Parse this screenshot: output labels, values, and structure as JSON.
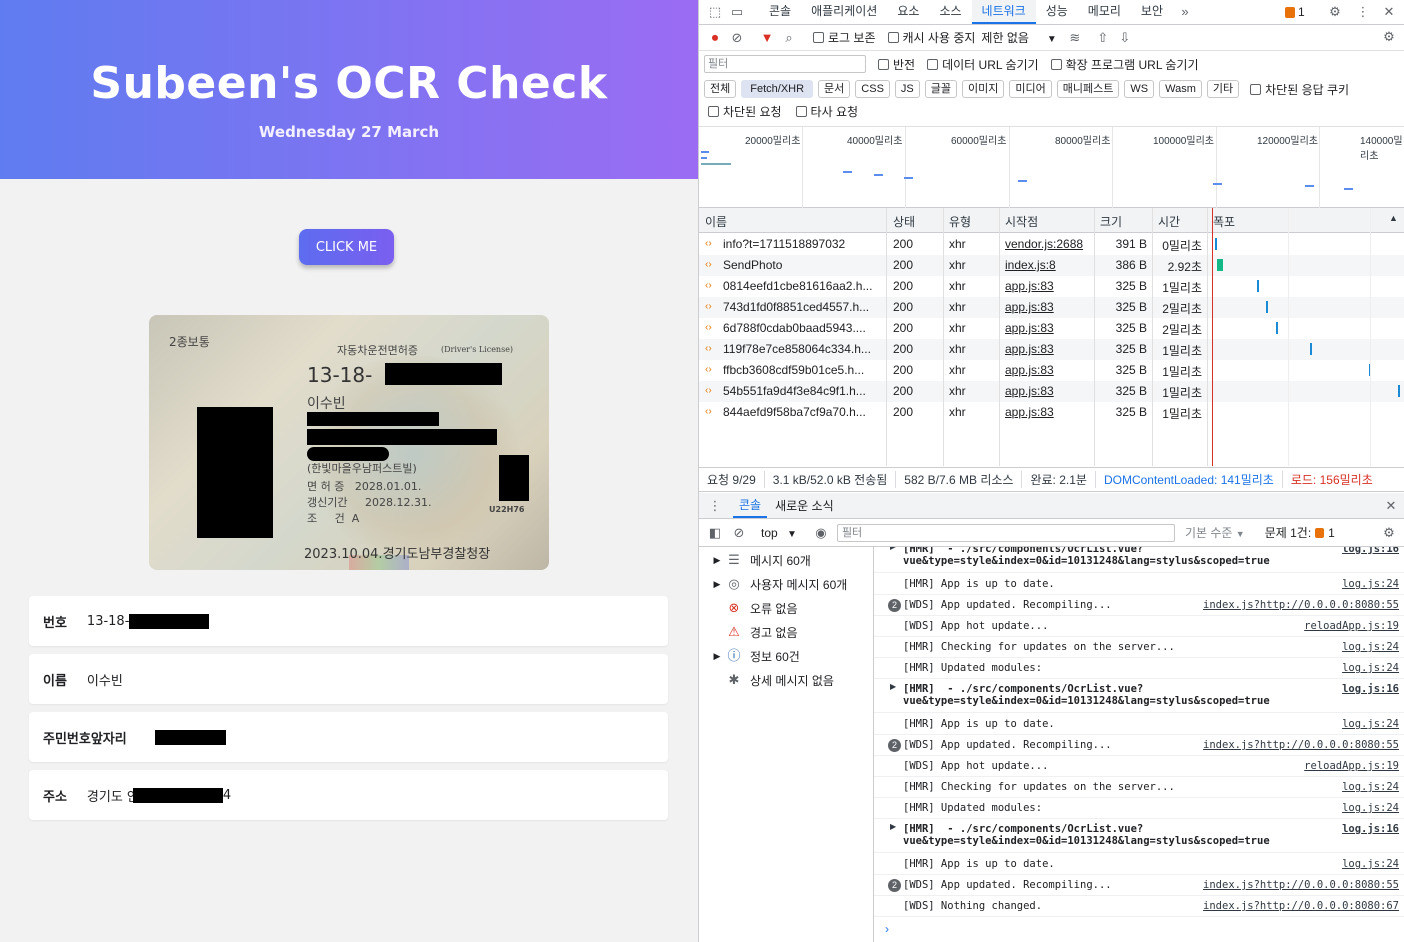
{
  "app": {
    "title": "Subeen's OCR Check",
    "date": "Wednesday 27 March",
    "button_label": "CLICK ME",
    "license": {
      "type": "2종보통",
      "header": "자동차운전면허증",
      "header_en": "(Driver's License)",
      "number_prefix": "13-18-",
      "name": "이수빈",
      "address_suffix": "(한빛마을우남퍼스트빌)",
      "renew": "면 허 증   2028.01.01.",
      "expiry": "갱신기간     2028.12.31.",
      "conditions": "조     건  A",
      "issue": "2023.10.04.경기도남부경찰청장",
      "code": "U22H76"
    },
    "fields": [
      {
        "label": "번호",
        "value": "13-18-"
      },
      {
        "label": "이름",
        "value": "이수빈"
      },
      {
        "label": "주민번호앞자리",
        "value": ""
      },
      {
        "label": "주소",
        "value": "경기도 안",
        "value_suffix": "4"
      }
    ]
  },
  "devtools": {
    "tabs": [
      "콘솔",
      "애플리케이션",
      "요소",
      "소스",
      "네트워크",
      "성능",
      "메모리",
      "보안"
    ],
    "active_tab": "네트워크",
    "issues_count": "1",
    "toolbar": {
      "preserve_log": "로그 보존",
      "disable_cache": "캐시 사용 중지",
      "throttle": "제한 없음"
    },
    "filter": {
      "placeholder": "필터",
      "invert": "반전",
      "hide_data_urls": "데이터 URL 숨기기",
      "hide_ext_urls": "확장 프로그램 URL 숨기기"
    },
    "types": [
      "전체",
      "Fetch/XHR",
      "문서",
      "CSS",
      "JS",
      "글꼴",
      "이미지",
      "미디어",
      "매니페스트",
      "WS",
      "Wasm",
      "기타"
    ],
    "active_type": "Fetch/XHR",
    "blocked_cookies": "차단된 응답 쿠키",
    "blocked_requests": "차단된 요청",
    "third_party": "타사 요청",
    "timeline_ticks": [
      "20000밀리초",
      "40000밀리초",
      "60000밀리초",
      "80000밀리초",
      "100000밀리초",
      "120000밀리초",
      "140000밀리초"
    ],
    "columns": [
      "이름",
      "상태",
      "유형",
      "시작점",
      "크기",
      "시간",
      "폭포"
    ],
    "requests": [
      {
        "name": "info?t=1711518897032",
        "status": "200",
        "type": "xhr",
        "initiator": "vendor.js:2688",
        "size": "391 B",
        "time": "0밀리초"
      },
      {
        "name": "SendPhoto",
        "status": "200",
        "type": "xhr",
        "initiator": "index.js:8",
        "size": "386 B",
        "time": "2.92초"
      },
      {
        "name": "0814eefd1cbe81616aa2.h...",
        "status": "200",
        "type": "xhr",
        "initiator": "app.js:83",
        "size": "325 B",
        "time": "1밀리초"
      },
      {
        "name": "743d1fd0f8851ced4557.h...",
        "status": "200",
        "type": "xhr",
        "initiator": "app.js:83",
        "size": "325 B",
        "time": "2밀리초"
      },
      {
        "name": "6d788f0cdab0baad5943....",
        "status": "200",
        "type": "xhr",
        "initiator": "app.js:83",
        "size": "325 B",
        "time": "2밀리초"
      },
      {
        "name": "119f78e7ce858064c334.h...",
        "status": "200",
        "type": "xhr",
        "initiator": "app.js:83",
        "size": "325 B",
        "time": "1밀리초"
      },
      {
        "name": "ffbcb3608cdf59b01ce5.h...",
        "status": "200",
        "type": "xhr",
        "initiator": "app.js:83",
        "size": "325 B",
        "time": "1밀리초"
      },
      {
        "name": "54b551fa9d4f3e84c9f1.h...",
        "status": "200",
        "type": "xhr",
        "initiator": "app.js:83",
        "size": "325 B",
        "time": "1밀리초"
      },
      {
        "name": "844aefd9f58ba7cf9a70.h...",
        "status": "200",
        "type": "xhr",
        "initiator": "app.js:83",
        "size": "325 B",
        "time": "1밀리초"
      }
    ],
    "summary": {
      "requests": "요청 9/29",
      "transferred": "3.1 kB/52.0 kB 전송됨",
      "resources": "582 B/7.6 MB 리소스",
      "finish": "완료: 2.1분",
      "dcl": "DOMContentLoaded: 141밀리초",
      "load": "로드: 156밀리초"
    },
    "drawer": {
      "tabs": [
        "콘솔",
        "새로운 소식"
      ],
      "context": "top",
      "filter_placeholder": "필터",
      "level": "기본 수준",
      "issues": "문제 1건:",
      "issues_count": "1"
    },
    "console_sidebar": [
      {
        "label": "메시지 60개",
        "icon": "list-icon"
      },
      {
        "label": "사용자 메시지 60개",
        "icon": "user-icon"
      },
      {
        "label": "오류 없음",
        "icon": "error-icon"
      },
      {
        "label": "경고 없음",
        "icon": "warning-icon"
      },
      {
        "label": "정보 60건",
        "icon": "info-icon"
      },
      {
        "label": "상세 메시지 없음",
        "icon": "bug-icon"
      }
    ],
    "console_logs": [
      {
        "msg": "[HMR]  - ./src/components/OcrList.vue?\nvue&type=style&index=0&id=10131248&lang=stylus&scoped=true",
        "src": "log.js:16",
        "kind": "tall-partial"
      },
      {
        "msg": "[HMR] App is up to date.",
        "src": "log.js:24",
        "kind": "plain"
      },
      {
        "msg": "[WDS] App updated. Recompiling...",
        "src": "index.js?http://0.0.0.0:8080:55",
        "kind": "badge",
        "badge": "2"
      },
      {
        "msg": "[WDS] App hot update...",
        "src": "reloadApp.js:19",
        "kind": "plain"
      },
      {
        "msg": "[HMR] Checking for updates on the server...",
        "src": "log.js:24",
        "kind": "plain"
      },
      {
        "msg": "[HMR] Updated modules:",
        "src": "log.js:24",
        "kind": "plain"
      },
      {
        "msg": "[HMR]  - ./src/components/OcrList.vue?\nvue&type=style&index=0&id=10131248&lang=stylus&scoped=true",
        "src": "log.js:16",
        "kind": "tall"
      },
      {
        "msg": "[HMR] App is up to date.",
        "src": "log.js:24",
        "kind": "plain"
      },
      {
        "msg": "[WDS] App updated. Recompiling...",
        "src": "index.js?http://0.0.0.0:8080:55",
        "kind": "badge",
        "badge": "2"
      },
      {
        "msg": "[WDS] App hot update...",
        "src": "reloadApp.js:19",
        "kind": "plain"
      },
      {
        "msg": "[HMR] Checking for updates on the server...",
        "src": "log.js:24",
        "kind": "plain"
      },
      {
        "msg": "[HMR] Updated modules:",
        "src": "log.js:24",
        "kind": "plain"
      },
      {
        "msg": "[HMR]  - ./src/components/OcrList.vue?\nvue&type=style&index=0&id=10131248&lang=stylus&scoped=true",
        "src": "log.js:16",
        "kind": "tall"
      },
      {
        "msg": "[HMR] App is up to date.",
        "src": "log.js:24",
        "kind": "plain"
      },
      {
        "msg": "[WDS] App updated. Recompiling...",
        "src": "index.js?http://0.0.0.0:8080:55",
        "kind": "badge",
        "badge": "2"
      },
      {
        "msg": "[WDS] Nothing changed.",
        "src": "index.js?http://0.0.0.0:8080:67",
        "kind": "plain"
      }
    ],
    "colors": {
      "accent": "#1a73e8",
      "record": "#d93025",
      "filter_active": "#d93025"
    }
  }
}
